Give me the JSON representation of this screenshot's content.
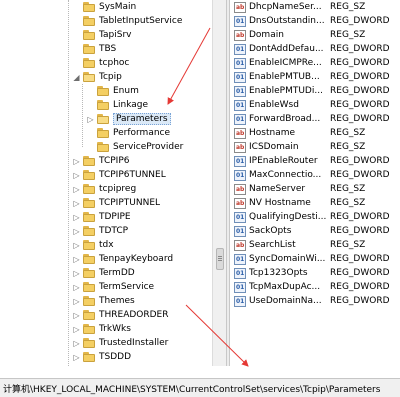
{
  "tree": {
    "items": [
      {
        "label": "SysMain",
        "expander": ""
      },
      {
        "label": "TabletInputService",
        "expander": ""
      },
      {
        "label": "TapiSrv",
        "expander": ""
      },
      {
        "label": "TBS",
        "expander": ""
      },
      {
        "label": "tcphoc",
        "expander": ""
      },
      {
        "label": "Tcpip",
        "expander": "◢"
      },
      {
        "label": "Enum",
        "expander": ""
      },
      {
        "label": "Linkage",
        "expander": ""
      },
      {
        "label": "Parameters",
        "expander": "▷"
      },
      {
        "label": "Performance",
        "expander": ""
      },
      {
        "label": "ServiceProvider",
        "expander": ""
      },
      {
        "label": "TCPIP6",
        "expander": "▷"
      },
      {
        "label": "TCPIP6TUNNEL",
        "expander": "▷"
      },
      {
        "label": "tcpipreg",
        "expander": "▷"
      },
      {
        "label": "TCPIPTUNNEL",
        "expander": "▷"
      },
      {
        "label": "TDPIPE",
        "expander": "▷"
      },
      {
        "label": "TDTCP",
        "expander": "▷"
      },
      {
        "label": "tdx",
        "expander": "▷"
      },
      {
        "label": "TenpayKeyboard",
        "expander": "▷"
      },
      {
        "label": "TermDD",
        "expander": "▷"
      },
      {
        "label": "TermService",
        "expander": "▷"
      },
      {
        "label": "Themes",
        "expander": "▷"
      },
      {
        "label": "THREADORDER",
        "expander": "▷"
      },
      {
        "label": "TrkWks",
        "expander": "▷"
      },
      {
        "label": "TrustedInstaller",
        "expander": "▷"
      },
      {
        "label": "TSDDD",
        "expander": "▷"
      }
    ],
    "selected": "Parameters"
  },
  "values": {
    "rows": [
      {
        "name": "DhcpNameSer...",
        "type": "REG_SZ",
        "kind": "sz"
      },
      {
        "name": "DnsOutstandin...",
        "type": "REG_DWORD",
        "kind": "bin"
      },
      {
        "name": "Domain",
        "type": "REG_SZ",
        "kind": "sz"
      },
      {
        "name": "DontAddDefau...",
        "type": "REG_DWORD",
        "kind": "bin"
      },
      {
        "name": "EnableICMPRe...",
        "type": "REG_DWORD",
        "kind": "bin"
      },
      {
        "name": "EnablePMTUB...",
        "type": "REG_DWORD",
        "kind": "bin"
      },
      {
        "name": "EnablePMTUDi...",
        "type": "REG_DWORD",
        "kind": "bin"
      },
      {
        "name": "EnableWsd",
        "type": "REG_DWORD",
        "kind": "bin"
      },
      {
        "name": "ForwardBroad...",
        "type": "REG_DWORD",
        "kind": "bin"
      },
      {
        "name": "Hostname",
        "type": "REG_SZ",
        "kind": "sz"
      },
      {
        "name": "ICSDomain",
        "type": "REG_SZ",
        "kind": "sz"
      },
      {
        "name": "IPEnableRouter",
        "type": "REG_DWORD",
        "kind": "bin"
      },
      {
        "name": "MaxConnectio...",
        "type": "REG_DWORD",
        "kind": "bin"
      },
      {
        "name": "NameServer",
        "type": "REG_SZ",
        "kind": "sz"
      },
      {
        "name": "NV Hostname",
        "type": "REG_SZ",
        "kind": "sz"
      },
      {
        "name": "QualifyingDesti...",
        "type": "REG_DWORD",
        "kind": "bin"
      },
      {
        "name": "SackOpts",
        "type": "REG_DWORD",
        "kind": "bin"
      },
      {
        "name": "SearchList",
        "type": "REG_SZ",
        "kind": "sz"
      },
      {
        "name": "SyncDomainWi...",
        "type": "REG_DWORD",
        "kind": "bin"
      },
      {
        "name": "Tcp1323Opts",
        "type": "REG_DWORD",
        "kind": "bin"
      },
      {
        "name": "TcpMaxDupAc...",
        "type": "REG_DWORD",
        "kind": "bin"
      },
      {
        "name": "UseDomainNa...",
        "type": "REG_DWORD",
        "kind": "bin"
      }
    ]
  },
  "status_bar": {
    "path": "计算机\\HKEY_LOCAL_MACHINE\\SYSTEM\\CurrentControlSet\\services\\Tcpip\\Parameters"
  },
  "icons": {
    "string_value": "string-value-icon",
    "binary_value": "dword-value-icon",
    "folder": "folder-icon"
  },
  "colors": {
    "annotation_arrow": "#e53935",
    "folder": "#f4cf63",
    "selection": "#dbe9f7"
  }
}
